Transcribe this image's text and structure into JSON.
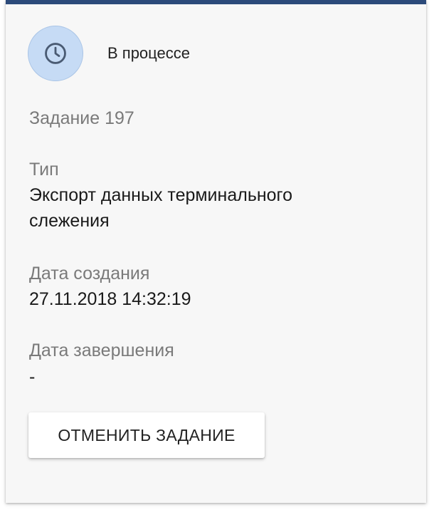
{
  "status": {
    "icon": "clock-icon",
    "text": "В процессе",
    "avatar_color": "#c6dbf5"
  },
  "task": {
    "title": "Задание 197"
  },
  "fields": {
    "type_label": "Тип",
    "type_value": "Экспорт данных терминального слежения",
    "created_label": "Дата создания",
    "created_value": "27.11.2018 14:32:19",
    "finished_label": "Дата завершения",
    "finished_value": "-"
  },
  "actions": {
    "cancel_label": "ОТМЕНИТЬ ЗАДАНИЕ"
  },
  "colors": {
    "accent_top_border": "#2c4a7a"
  }
}
